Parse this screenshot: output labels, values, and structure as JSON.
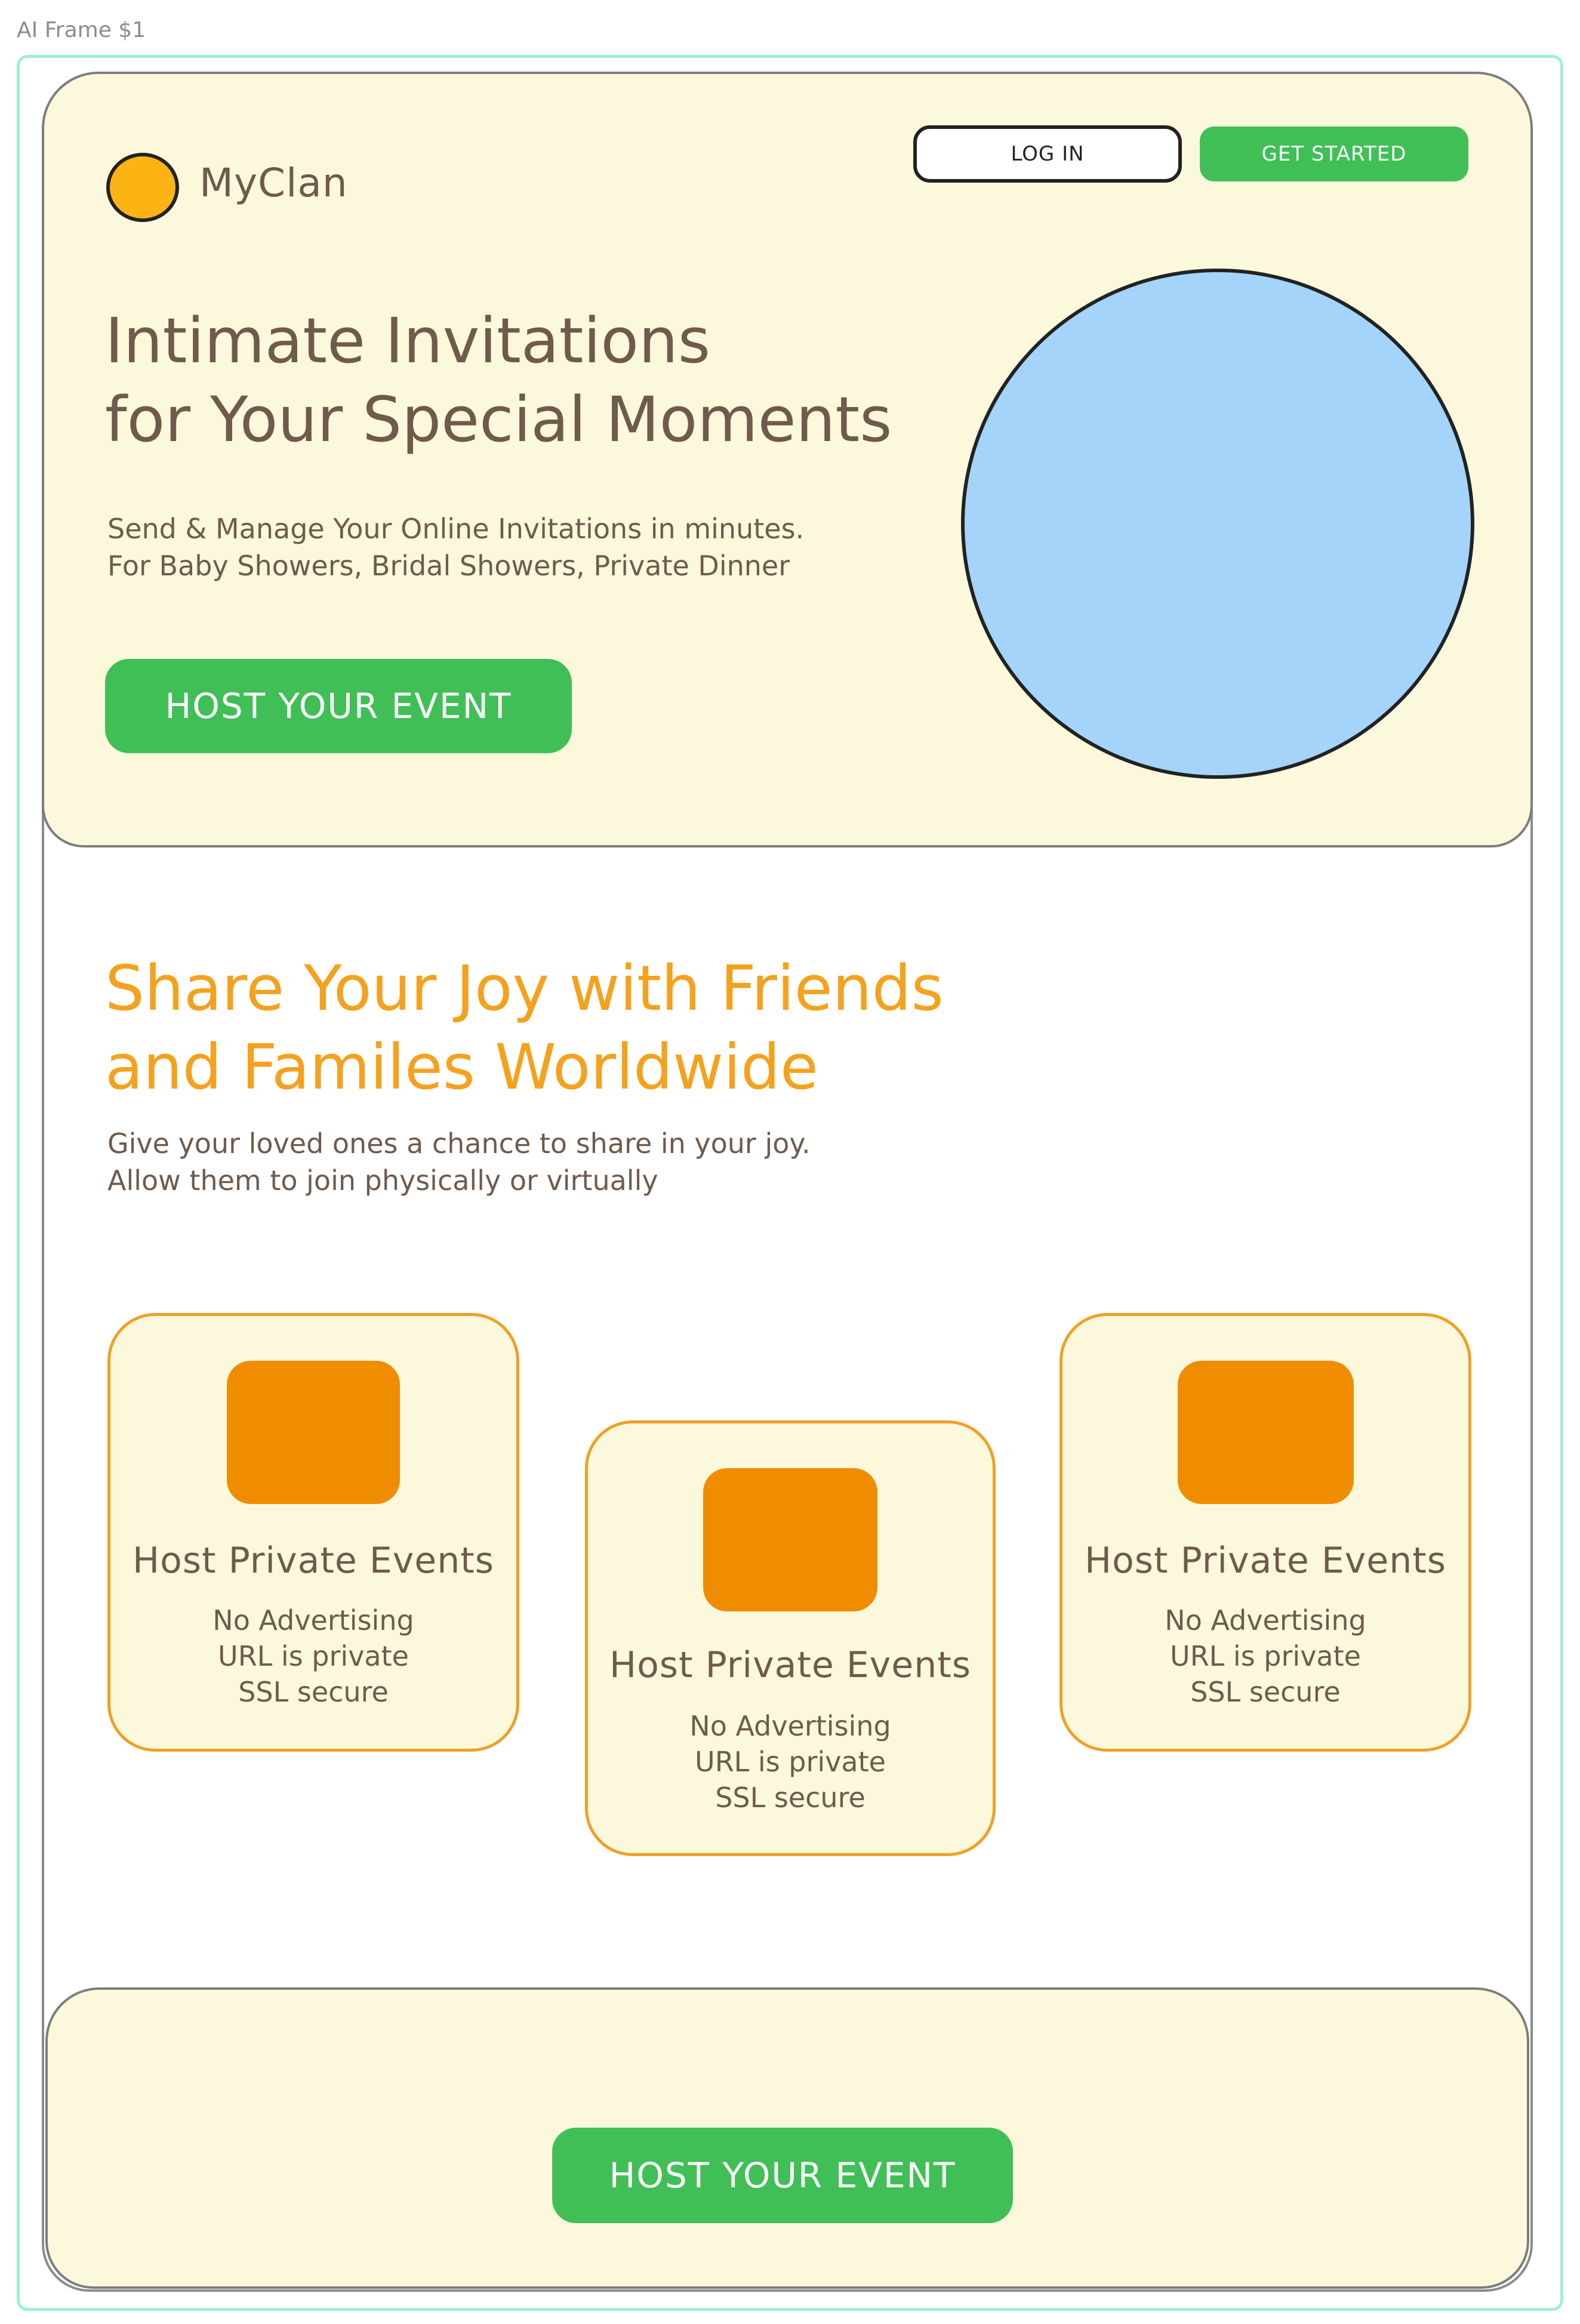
{
  "frame": {
    "label": "AI Frame $1"
  },
  "header": {
    "brand": "MyClan",
    "login_label": "LOG IN",
    "getstarted_label": "GET STARTED"
  },
  "hero": {
    "title_line1": "Intimate Invitations",
    "title_line2": "for Your Special Moments",
    "subtitle_line1": "Send & Manage Your Online Invitations in minutes.",
    "subtitle_line2": "For Baby Showers, Bridal Showers, Private Dinner",
    "cta_label": "HOST YOUR EVENT"
  },
  "share": {
    "title_line1": "Share Your Joy with Friends",
    "title_line2": "and Familes Worldwide",
    "subtitle_line1": "Give your loved ones a chance to share in your joy.",
    "subtitle_line2": "Allow them to join physically or virtually"
  },
  "cards": [
    {
      "title": "Host Private Events",
      "lines": [
        "No Advertising",
        "URL is private",
        "SSL secure"
      ]
    },
    {
      "title": "Host Private Events",
      "lines": [
        "No Advertising",
        "URL is private",
        "SSL secure"
      ]
    },
    {
      "title": "Host Private Events",
      "lines": [
        "No Advertising",
        "URL is private",
        "SSL secure"
      ]
    }
  ],
  "footer": {
    "cta_label": "HOST YOUR EVENT"
  },
  "colors": {
    "cream": "#fcf8dc",
    "green": "#40bf57",
    "orange": "#f08c00",
    "heading_orange": "#f4a21e",
    "brown_text": "#6f5a4c",
    "blue_circle": "#a4d4fa",
    "logo_yellow": "#fcb414"
  }
}
